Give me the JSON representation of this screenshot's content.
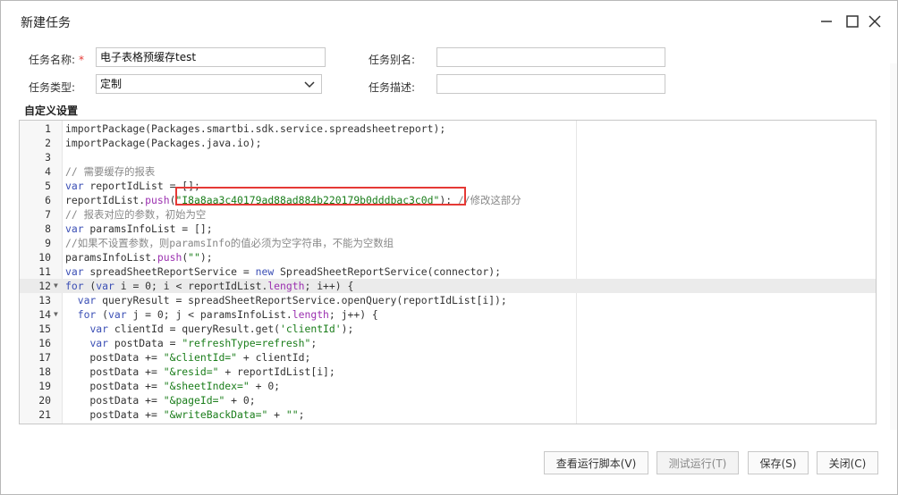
{
  "dialog": {
    "title": "新建任务",
    "controls": {
      "minimize": "—",
      "maximize": "☐",
      "close": "✕"
    }
  },
  "form": {
    "name_label": "任务名称:",
    "required_mark": "*",
    "name_value": "电子表格预缓存test",
    "alias_label": "任务别名:",
    "alias_value": "",
    "type_label": "任务类型:",
    "type_value": "定制",
    "desc_label": "任务描述:",
    "desc_value": ""
  },
  "section_title": "自定义设置",
  "code": {
    "active_line": 12,
    "fold_lines": [
      12,
      14
    ],
    "lines": [
      "importPackage(Packages.smartbi.sdk.service.spreadsheetreport);",
      "importPackage(Packages.java.io);",
      "",
      "// 需要缓存的报表",
      "var reportIdList = [];",
      "reportIdList.push(\"I8a8aa3c40179ad88ad884b220179b0dddbac3c0d\"); //修改这部分",
      "// 报表对应的参数，初始为空",
      "var paramsInfoList = [];",
      "//如果不设置参数，则paramsInfo的值必须为空字符串，不能为空数组",
      "paramsInfoList.push(\"\");",
      "var spreadSheetReportService = new SpreadSheetReportService(connector);",
      "for (var i = 0; i < reportIdList.length; i++) {",
      "  var queryResult = spreadSheetReportService.openQuery(reportIdList[i]);",
      "  for (var j = 0; j < paramsInfoList.length; j++) {",
      "    var clientId = queryResult.get('clientId');",
      "    var postData = \"refreshType=refresh\";",
      "    postData += \"&clientId=\" + clientId;",
      "    postData += \"&resid=\" + reportIdList[i];",
      "    postData += \"&sheetIndex=\" + 0;",
      "    postData += \"&pageId=\" + 0;",
      "    postData += \"&writeBackData=\" + \"\";"
    ]
  },
  "buttons": {
    "view_script": "查看运行脚本(V)",
    "test_run": "测试运行(T)",
    "save": "保存(S)",
    "close": "关闭(C)"
  },
  "colors": {
    "highlight_border": "#e53935",
    "keyword": "#3b4fb5",
    "string": "#1a7d1a",
    "comment": "#888888"
  }
}
